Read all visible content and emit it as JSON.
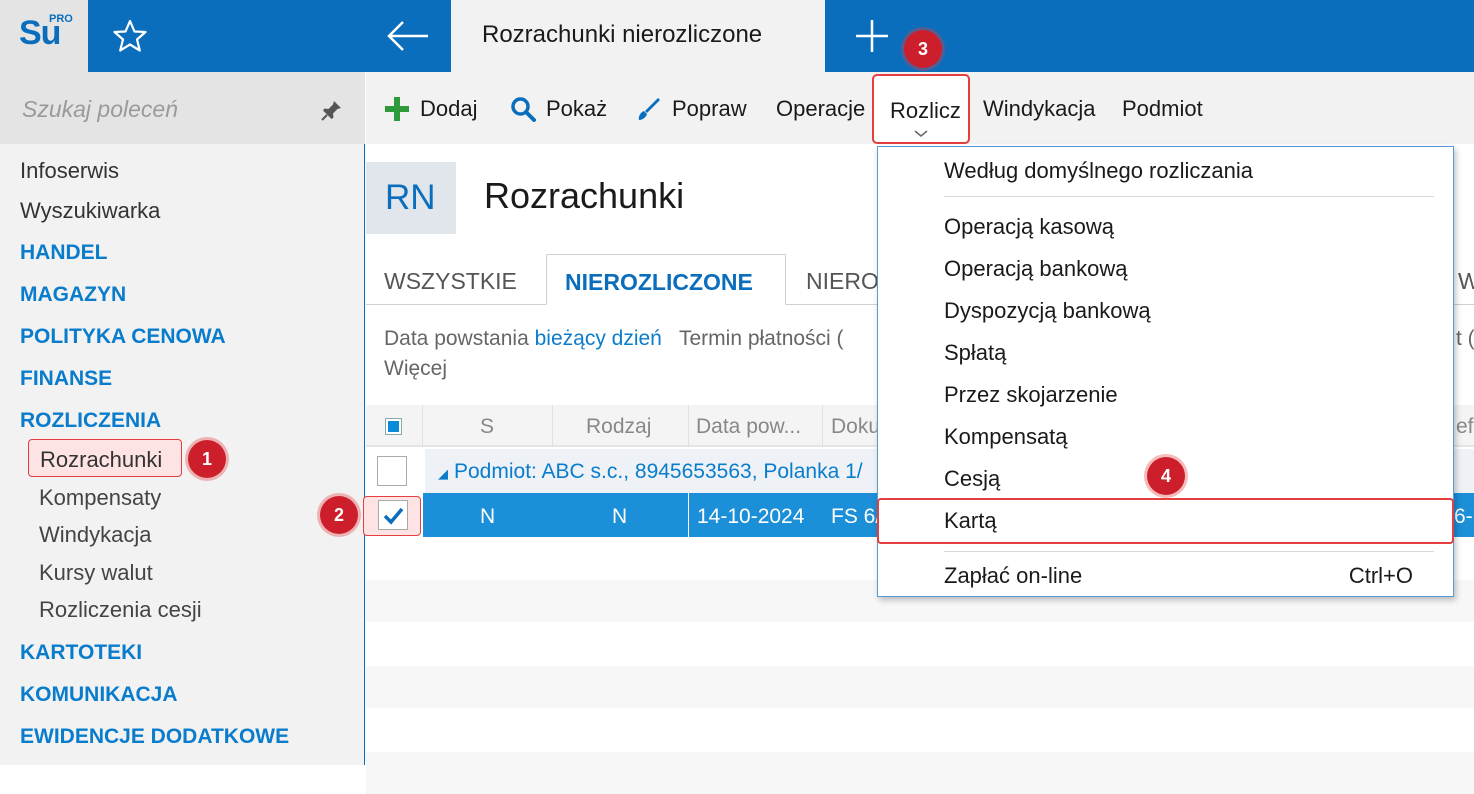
{
  "app": {
    "logo_main": "Su",
    "logo_sup": "PRO",
    "active_tab": "Rozrachunki nierozliczone"
  },
  "sidebar": {
    "search_placeholder": "Szukaj poleceń",
    "items": [
      {
        "label": "Infoserwis"
      },
      {
        "label": "Wyszukiwarka"
      }
    ],
    "categories": {
      "handel": "HANDEL",
      "magazyn": "MAGAZYN",
      "polityka": "POLITYKA CENOWA",
      "finanse": "FINANSE",
      "rozliczenia": "ROZLICZENIA",
      "kartoteki": "KARTOTEKI",
      "komunikacja": "KOMUNIKACJA",
      "ewidencje": "EWIDENCJE DODATKOWE"
    },
    "sub_items": [
      {
        "label": "Rozrachunki"
      },
      {
        "label": "Kompensaty"
      },
      {
        "label": "Windykacja"
      },
      {
        "label": "Kursy walut"
      },
      {
        "label": "Rozliczenia cesji"
      }
    ]
  },
  "toolbar": {
    "dodaj": "Dodaj",
    "pokaz": "Pokaż",
    "popraw": "Popraw",
    "operacje": "Operacje",
    "rozlicz": "Rozlicz",
    "windykacja": "Windykacja",
    "podmiot": "Podmiot"
  },
  "header": {
    "badge": "RN",
    "title": "Rozrachunki"
  },
  "tabs": {
    "wszystkie": "WSZYSTKIE",
    "nierozliczone": "NIEROZLICZONE",
    "next_partial": "NIERO",
    "right_partial": "W"
  },
  "filters": {
    "data_label": "Data powstania",
    "data_value": "bieżący dzień",
    "termin_label": "Termin płatności (",
    "right_partial": "t (",
    "more": "Więcej"
  },
  "grid": {
    "columns": {
      "s": "S",
      "rodzaj": "Rodzaj",
      "data": "Data pow...",
      "dokument": "Doku",
      "right_partial": "ef"
    },
    "group_row": "Podmiot: ABC s.c., 8945653563, Polanka  1/",
    "selected_row": {
      "s": "N",
      "rodzaj": "N",
      "data": "14-10-2024",
      "dokument": "FS 6/",
      "right_partial": "6-"
    }
  },
  "dropdown": {
    "items": [
      {
        "label": "Według domyślnego rozliczania"
      },
      {
        "label": "Operacją kasową"
      },
      {
        "label": "Operacją bankową"
      },
      {
        "label": "Dyspozycją bankową"
      },
      {
        "label": "Spłatą"
      },
      {
        "label": "Przez skojarzenie"
      },
      {
        "label": "Kompensatą"
      },
      {
        "label": "Cesją"
      },
      {
        "label": "Kartą"
      },
      {
        "label": "Zapłać on-line",
        "shortcut": "Ctrl+O"
      }
    ]
  },
  "badges": {
    "b1": "1",
    "b2": "2",
    "b3": "3",
    "b4": "4"
  },
  "colors": {
    "brand_blue": "#0a6ebd",
    "link_blue": "#0a7ccc",
    "selection_blue": "#1c8fd9",
    "highlight_red": "#e53e3e",
    "badge_red": "#cc1f2b"
  }
}
